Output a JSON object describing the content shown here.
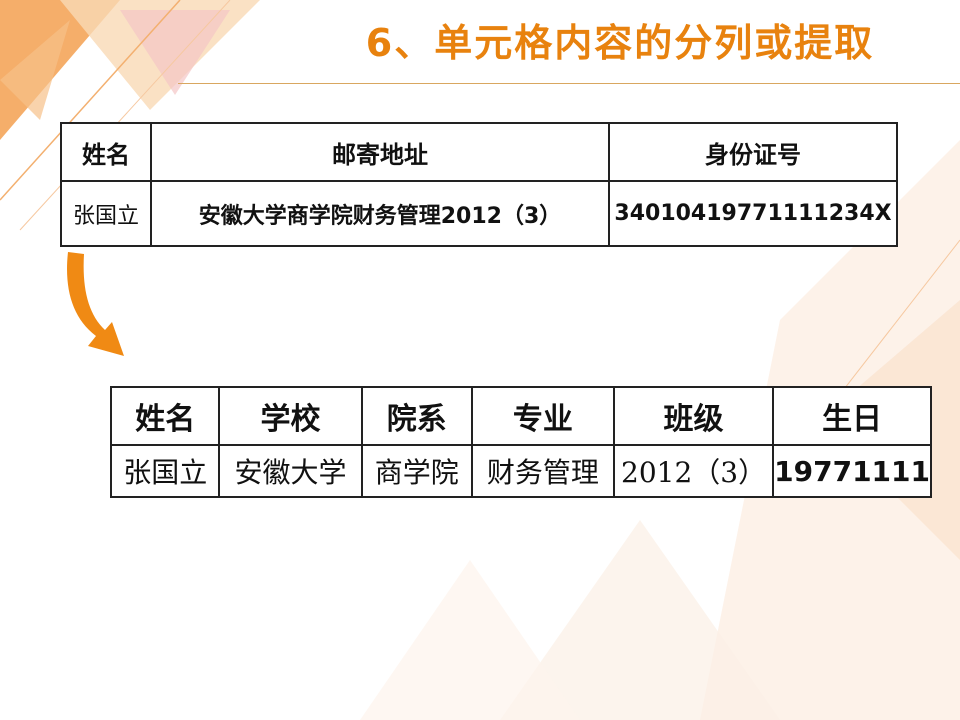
{
  "slide": {
    "title": "6、单元格内容的分列或提取"
  },
  "source_table": {
    "headers": [
      "姓名",
      "邮寄地址",
      "身份证号"
    ],
    "row": [
      "张国立",
      "安徽大学商学院财务管理2012（3）",
      "34010419771111234X"
    ]
  },
  "result_table": {
    "headers": [
      "姓名",
      "学校",
      "院系",
      "专业",
      "班级",
      "生日"
    ],
    "row": [
      "张国立",
      "安徽大学",
      "商学院",
      "财务管理",
      "2012（3）",
      "19771111"
    ]
  },
  "colors": {
    "accent": "#E8820E",
    "arrow": "#F08A14",
    "decor_light": "#F9D9B5",
    "decor_pink": "#F4C6C6"
  },
  "icons": {
    "arrow": "curved-down-arrow-icon"
  }
}
